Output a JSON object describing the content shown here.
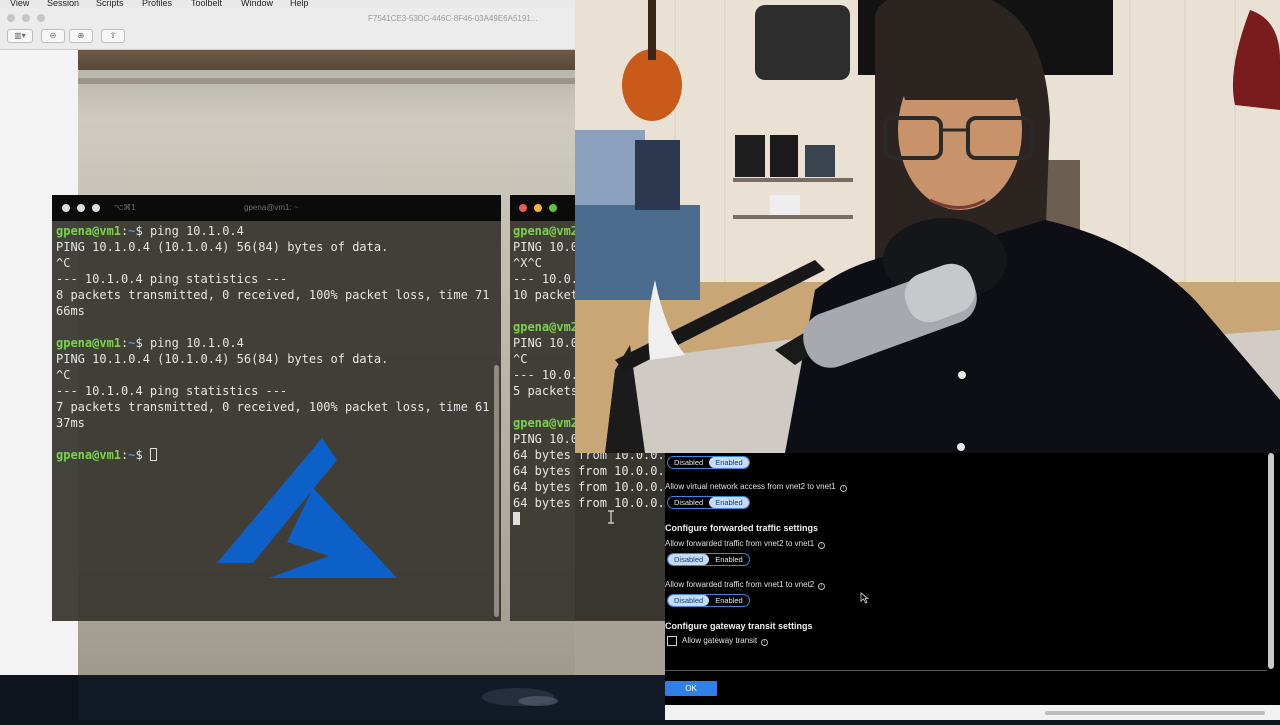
{
  "mac_menu": {
    "items": [
      "View",
      "Session",
      "Scripts",
      "Profiles",
      "Toolbelt",
      "Window",
      "Help"
    ]
  },
  "preview_window": {
    "title": "F7541CE3-53DC-446C-8F46-03A49E6A5191..."
  },
  "terminal_main": {
    "title": "gpena@vm1: ~",
    "shortcut": "⌥⌘1",
    "lines": [
      {
        "prompt": "gpena@vm1",
        "path": "~",
        "cmd": "ping 10.1.0.4"
      },
      {
        "text": "PING 10.1.0.4 (10.1.0.4) 56(84) bytes of data."
      },
      {
        "text": "^C"
      },
      {
        "text": "--- 10.1.0.4 ping statistics ---"
      },
      {
        "text": "8 packets transmitted, 0 received, 100% packet loss, time 71"
      },
      {
        "text": "66ms"
      },
      {
        "text": ""
      },
      {
        "prompt": "gpena@vm1",
        "path": "~",
        "cmd": "ping 10.1.0.4"
      },
      {
        "text": "PING 10.1.0.4 (10.1.0.4) 56(84) bytes of data."
      },
      {
        "text": "^C"
      },
      {
        "text": "--- 10.1.0.4 ping statistics ---"
      },
      {
        "text": "7 packets transmitted, 0 received, 100% packet loss, time 61"
      },
      {
        "text": "37ms"
      },
      {
        "text": ""
      },
      {
        "prompt": "gpena@vm1",
        "path": "~",
        "cmd": ""
      }
    ]
  },
  "terminal_second": {
    "lines": [
      "gpena@vm2",
      "PING 10.0",
      "^X^C",
      "--- 10.0.",
      "10 packet",
      "",
      "gpena@vm2",
      "PING 10.0",
      "^C",
      "--- 10.0.",
      "5 packets",
      "",
      "gpena@vm2",
      "PING 10.0.",
      "64 bytes from 10.0.0.",
      "64 bytes from 10.0.0.",
      "64 bytes from 10.0.0.",
      "64 bytes from 10.0.0."
    ]
  },
  "azure_panel": {
    "toggle_disabled": "Disabled",
    "toggle_enabled": "Enabled",
    "top_toggle_selected": "Enabled",
    "vnet_access_label": "Allow virtual network access from vnet2 to vnet1",
    "vnet_access_selected": "Enabled",
    "forwarded_heading": "Configure forwarded traffic settings",
    "fwd_vnet2_label": "Allow forwarded traffic from vnet2 to vnet1",
    "fwd_vnet2_selected": "Disabled",
    "fwd_vnet1_label": "Allow forwarded traffic from vnet1 to vnet2",
    "fwd_vnet1_selected": "Disabled",
    "gateway_heading": "Configure gateway transit settings",
    "gateway_checkbox_label": "Allow gateway transit",
    "gateway_checked": false,
    "ok_label": "OK"
  },
  "icons": [
    "azure-logo",
    "info-icon",
    "mouse-pointer-icon",
    "text-cursor-icon"
  ],
  "colors": {
    "azure_blue": "#0a63d6",
    "prompt_green": "#7cd34a",
    "prompt_blue": "#4d8fd6",
    "toggle_border": "#3b86e0",
    "ok_button": "#2f80e8"
  }
}
